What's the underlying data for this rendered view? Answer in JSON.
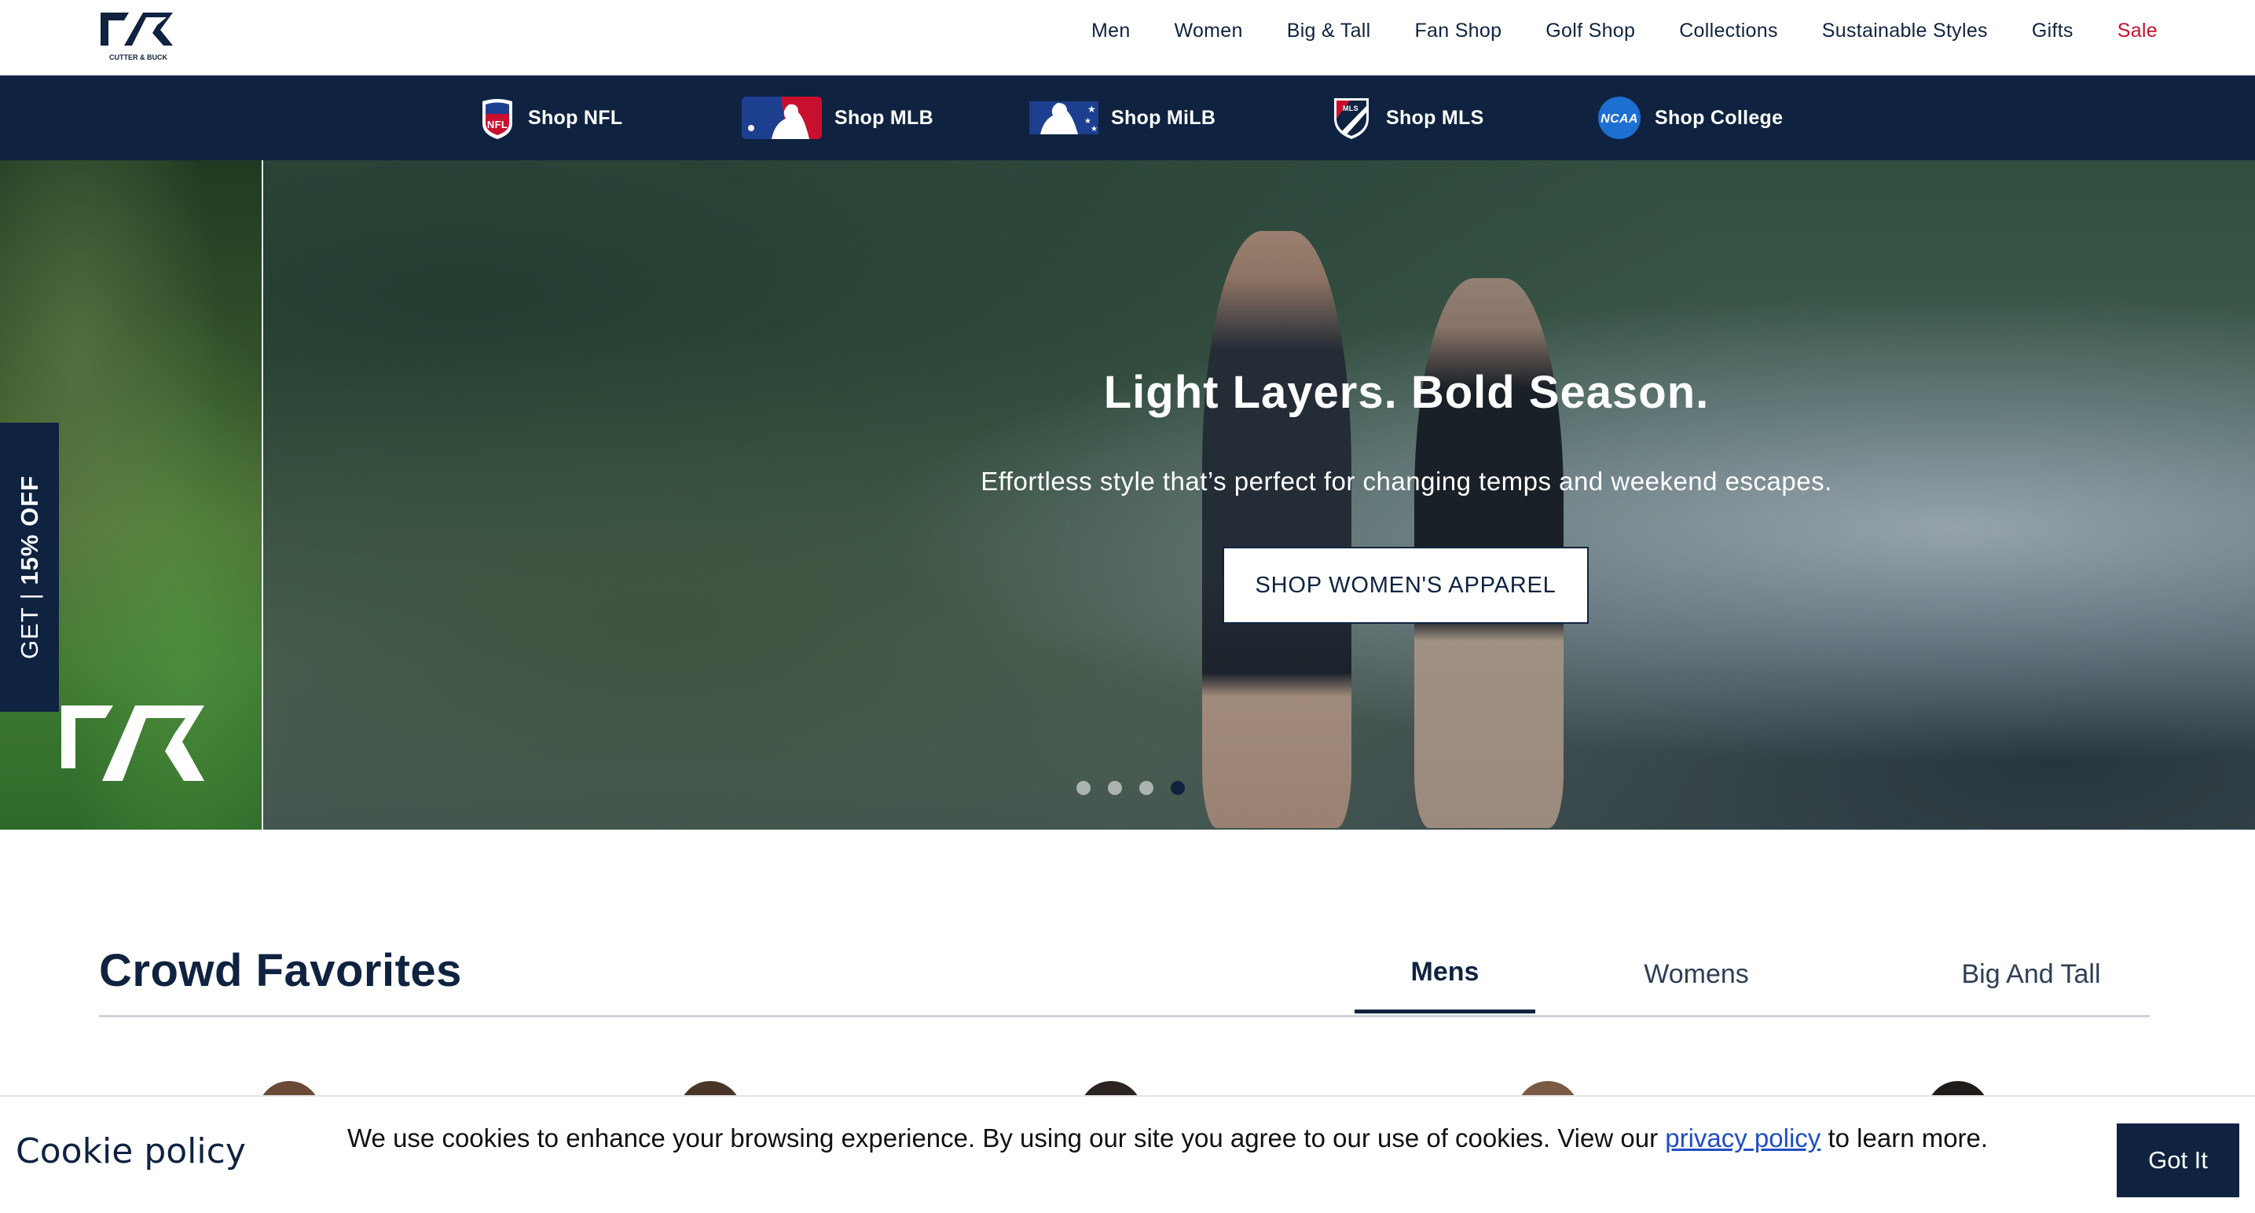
{
  "brand": {
    "logo_text": "CUTTER & BUCK",
    "navy": "#0f2340",
    "sale_red": "#c8102e"
  },
  "nav": {
    "items": [
      "Men",
      "Women",
      "Big & Tall",
      "Fan Shop",
      "Golf Shop",
      "Collections",
      "Sustainable Styles",
      "Gifts",
      "Sale"
    ]
  },
  "league_bar": {
    "items": [
      {
        "label": "Shop NFL",
        "icon": "nfl-shield-icon"
      },
      {
        "label": "Shop MLB",
        "icon": "mlb-logo-icon"
      },
      {
        "label": "Shop MiLB",
        "icon": "milb-logo-icon"
      },
      {
        "label": "Shop MLS",
        "icon": "mls-shield-icon"
      },
      {
        "label": "Shop College",
        "icon": "ncaa-logo-icon"
      }
    ]
  },
  "promo_tab": {
    "prefix": "GET | ",
    "bold": "15% OFF"
  },
  "hero": {
    "title": "Light Layers. Bold Season.",
    "subtitle": "Effortless style that’s perfect for changing temps and weekend escapes.",
    "cta": "SHOP WOMEN'S APPAREL",
    "slide_count": 4,
    "active_slide": 4
  },
  "crowd_favorites": {
    "title": "Crowd Favorites",
    "tabs": [
      "Mens",
      "Womens",
      "Big And Tall"
    ],
    "active_tab": "Mens"
  },
  "cookie": {
    "title": "Cookie policy",
    "text_before": "We use cookies to enhance your browsing experience. By using our site you agree to our use of cookies. View our ",
    "link": "privacy policy",
    "text_after": " to learn more.",
    "button": "Got It"
  }
}
